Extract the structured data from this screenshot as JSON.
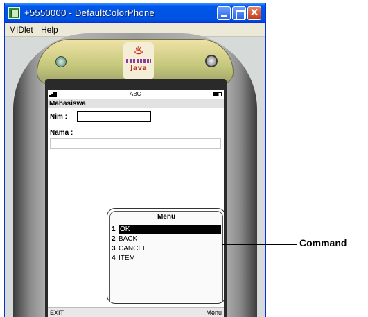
{
  "window": {
    "title": "+5550000 - DefaultColorPhone",
    "close_glyph": "✕"
  },
  "menubar": {
    "items": [
      "MIDlet",
      "Help"
    ]
  },
  "phone": {
    "logo_text": "Java"
  },
  "screen": {
    "status": {
      "input_mode": "ABC"
    },
    "title": "Mahasiswa",
    "form": {
      "nim_label": "Nim :",
      "nim_value": "",
      "nama_label": "Nama :",
      "nama_value": ""
    },
    "menu": {
      "header": "Menu",
      "items": [
        {
          "num": "1",
          "label": "OK",
          "selected": true
        },
        {
          "num": "2",
          "label": "BACK",
          "selected": false
        },
        {
          "num": "3",
          "label": "CANCEL",
          "selected": false
        },
        {
          "num": "4",
          "label": "ITEM",
          "selected": false
        }
      ]
    },
    "softkeys": {
      "left": "EXIT",
      "right": "Menu"
    }
  },
  "annotation": {
    "label": "Command"
  }
}
